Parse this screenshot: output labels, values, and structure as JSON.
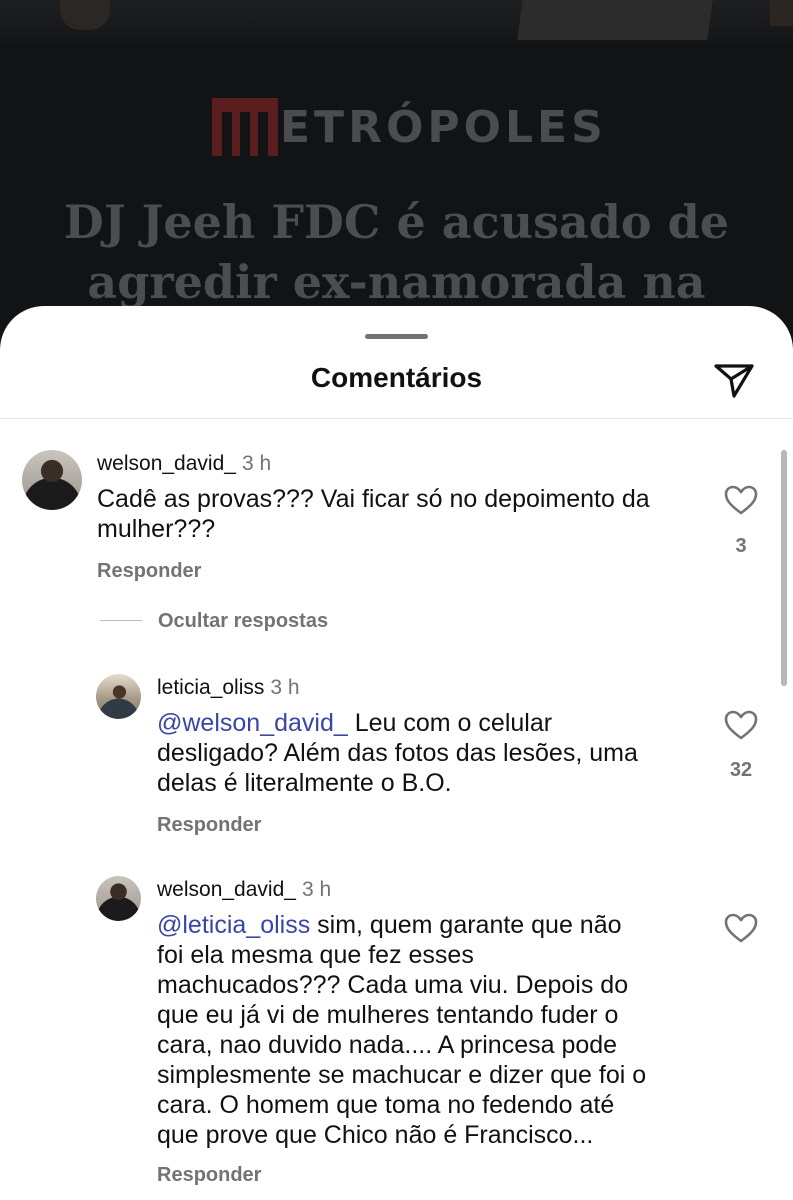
{
  "background_post": {
    "logo_text": "ETRÓPOLES",
    "headline_line1": "DJ Jeeh FDC é acusado de",
    "headline_line2": "agredir ex-namorada na"
  },
  "sheet": {
    "title": "Comentários",
    "share_icon": "paper-plane-icon"
  },
  "comments": [
    {
      "username": "welson_david_",
      "time": "3 h",
      "text_line1": "Cadê as provas??? Vai ficar só no depoimento da",
      "text_line2": "mulher???",
      "likes": "3",
      "reply_label": "Responder"
    }
  ],
  "hide_replies_label": "Ocultar respostas",
  "replies": [
    {
      "username": "leticia_oliss",
      "time": "3 h",
      "mention": "@welson_david_",
      "text_line1": " Leu com o celular",
      "text_line2": "desligado? Além das fotos das lesões, uma",
      "text_line3": "delas é literalmente o B.O.",
      "likes": "32",
      "reply_label": "Responder"
    },
    {
      "username": "welson_david_",
      "time": "3 h",
      "mention": "@leticia_oliss",
      "text_line1": " sim, quem garante que não",
      "text_line2": "foi ela mesma que fez esses",
      "text_line3": "machucados??? Cada uma viu. Depois do",
      "text_line4": "que eu já vi de mulheres tentando fuder o",
      "text_line5": "cara, nao duvido nada.... A princesa pode",
      "text_line6": "simplesmente se machucar e dizer que foi o",
      "text_line7": "cara. O homem que toma no fedendo até",
      "text_line8": "que prove que Chico não é Francisco...",
      "reply_label": "Responder"
    }
  ]
}
